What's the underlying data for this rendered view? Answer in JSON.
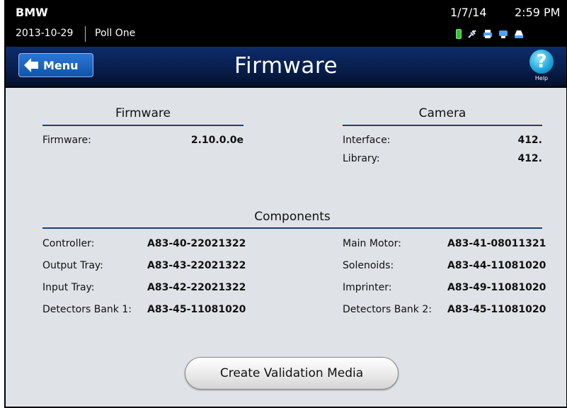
{
  "status_bar": {
    "app": "BMW",
    "date": "2013-10-29",
    "poll": "Poll One",
    "day": "1/7/14",
    "time": "2:59 PM",
    "icons": [
      "battery-icon",
      "plug-icon",
      "printer-icon",
      "network-icon",
      "scanner-icon"
    ]
  },
  "header": {
    "menu_label": "Menu",
    "title": "Firmware",
    "help_label": "Help"
  },
  "firmware_section": {
    "title": "Firmware",
    "rows": [
      {
        "label": "Firmware:",
        "value": "2.10.0.0e"
      }
    ]
  },
  "camera_section": {
    "title": "Camera",
    "rows": [
      {
        "label": "Interface:",
        "value": "412."
      },
      {
        "label": "Library:",
        "value": "412."
      }
    ]
  },
  "components_section": {
    "title": "Components",
    "left": [
      {
        "label": "Controller:",
        "value": "A83-40-22021322"
      },
      {
        "label": "Output Tray:",
        "value": "A83-43-22021322"
      },
      {
        "label": "Input Tray:",
        "value": "A83-42-22021322"
      },
      {
        "label": "Detectors Bank 1:",
        "value": "A83-45-11081020"
      }
    ],
    "right": [
      {
        "label": "Main Motor:",
        "value": "A83-41-08011321"
      },
      {
        "label": "Solenoids:",
        "value": "A83-44-11081020"
      },
      {
        "label": "Imprinter:",
        "value": "A83-49-11081020"
      },
      {
        "label": "Detectors Bank 2:",
        "value": "A83-45-11081020"
      }
    ]
  },
  "actions": {
    "create_validation_media": "Create Validation Media"
  },
  "colors": {
    "background": "#dfe3e8",
    "header_blue": "#0d2c6b",
    "accent_rule": "#1c3f7e",
    "menu_button": "#1e66c0"
  }
}
